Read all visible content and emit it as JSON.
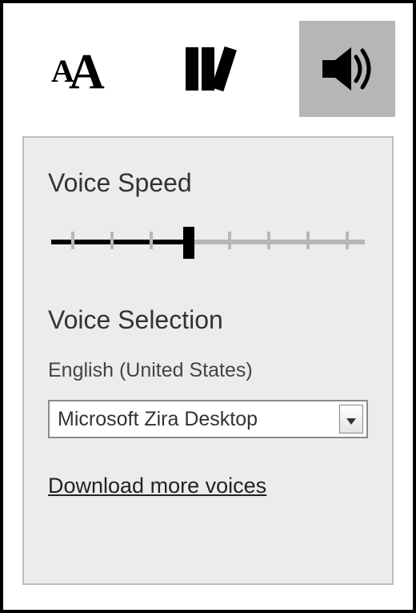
{
  "tabs": {
    "text": {
      "name": "text-size-tab",
      "active": false
    },
    "library": {
      "name": "library-tab",
      "active": false
    },
    "audio": {
      "name": "audio-tab",
      "active": true
    }
  },
  "speed": {
    "heading": "Voice Speed",
    "ticks": 8,
    "value": 4
  },
  "selection": {
    "heading": "Voice Selection",
    "language": "English (United States)",
    "voice": "Microsoft Zira Desktop"
  },
  "link": "Download more voices"
}
